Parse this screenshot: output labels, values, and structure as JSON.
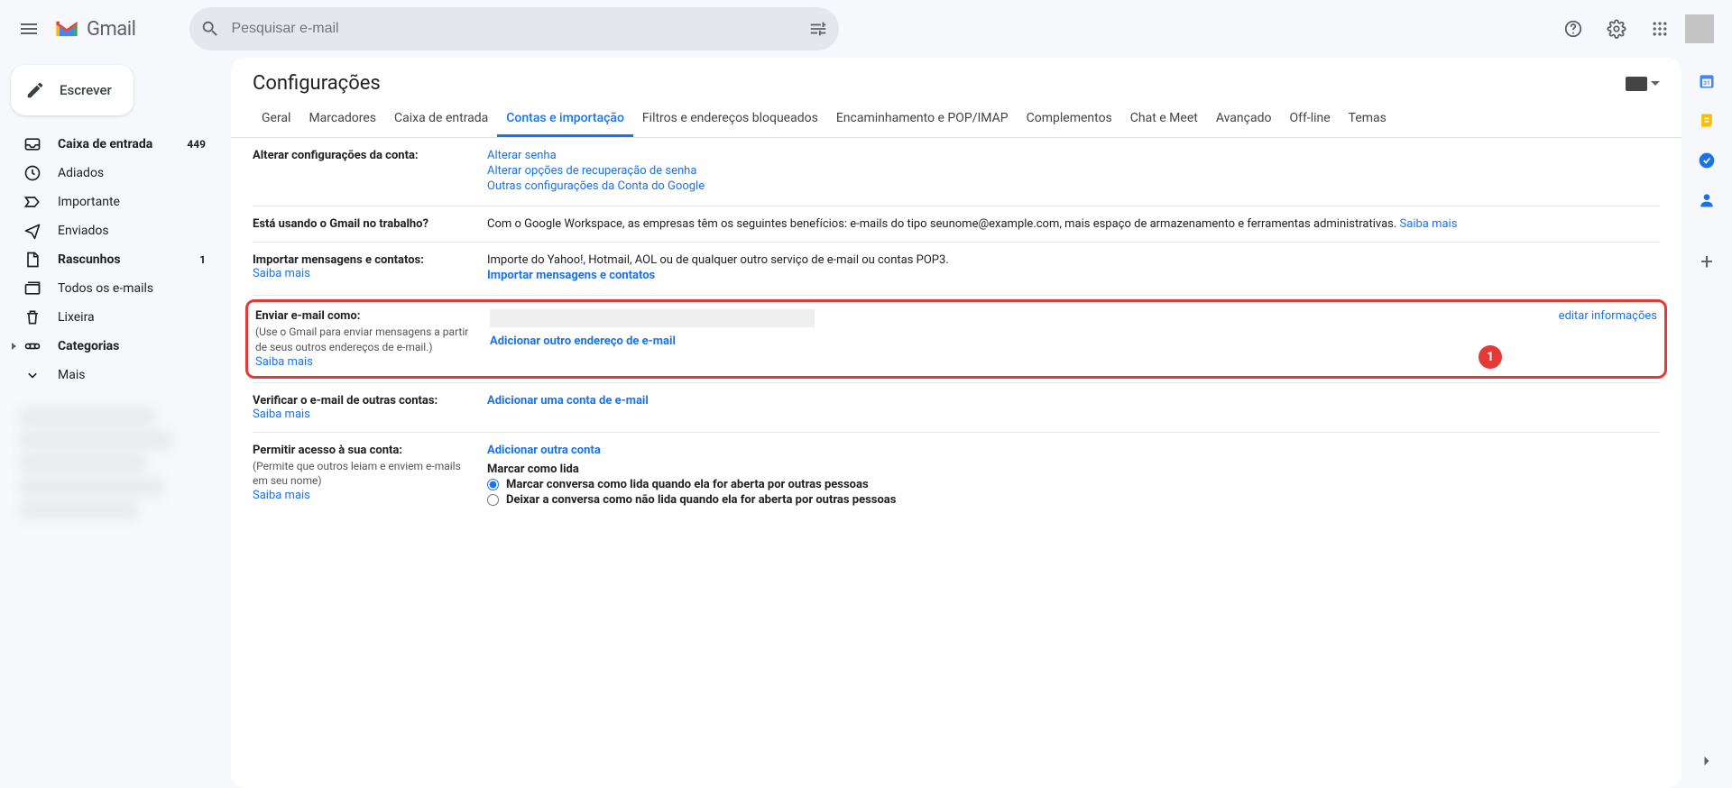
{
  "header": {
    "logo_text": "Gmail",
    "search_placeholder": "Pesquisar e-mail"
  },
  "sidebar": {
    "compose": "Escrever",
    "items": [
      {
        "icon": "inbox",
        "label": "Caixa de entrada",
        "count": "449",
        "bold": true
      },
      {
        "icon": "clock",
        "label": "Adiados"
      },
      {
        "icon": "important",
        "label": "Importante"
      },
      {
        "icon": "sent",
        "label": "Enviados"
      },
      {
        "icon": "draft",
        "label": "Rascunhos",
        "count": "1",
        "bold": true
      },
      {
        "icon": "allmail",
        "label": "Todos os e-mails"
      },
      {
        "icon": "trash",
        "label": "Lixeira"
      },
      {
        "icon": "category",
        "label": "Categorias",
        "caret": true,
        "bold": true
      },
      {
        "icon": "more",
        "label": "Mais"
      }
    ]
  },
  "settings": {
    "title": "Configurações",
    "tabs": [
      "Geral",
      "Marcadores",
      "Caixa de entrada",
      "Contas e importação",
      "Filtros e endereços bloqueados",
      "Encaminhamento e POP/IMAP",
      "Complementos",
      "Chat e Meet",
      "Avançado",
      "Off-line",
      "Temas"
    ],
    "active_tab_index": 3,
    "rows": {
      "account": {
        "title": "Alterar configurações da conta:",
        "links": [
          "Alterar senha",
          "Alterar opções de recuperação de senha",
          "Outras configurações da Conta do Google"
        ]
      },
      "work": {
        "title": "Está usando o Gmail no trabalho?",
        "body_pre": "Com o Google Workspace, as empresas têm os seguintes benefícios: e-mails do tipo seunome@example.com, mais espaço de armazenamento e ferramentas administrativas. ",
        "learn": "Saiba mais"
      },
      "import": {
        "title": "Importar mensagens e contatos:",
        "learn": "Saiba mais",
        "body": "Importe do Yahoo!, Hotmail, AOL ou de qualquer outro serviço de e-mail ou contas POP3.",
        "action": "Importar mensagens e contatos"
      },
      "sendas": {
        "title": "Enviar e-mail como:",
        "subtitle": "(Use o Gmail para enviar mensagens a partir de seus outros endereços de e-mail.)",
        "learn": "Saiba mais",
        "action": "Adicionar outro endereço de e-mail",
        "edit": "editar informações",
        "badge": "1"
      },
      "check": {
        "title": "Verificar o e-mail de outras contas:",
        "learn": "Saiba mais",
        "action": "Adicionar uma conta de e-mail"
      },
      "grant": {
        "title": "Permitir acesso à sua conta:",
        "subtitle": "(Permite que outros leiam e enviem e-mails em seu nome)",
        "learn": "Saiba mais",
        "action": "Adicionar outra conta",
        "mark_header": "Marcar como lida",
        "radio1": "Marcar conversa como lida quando ela for aberta por outras pessoas",
        "radio2": "Deixar a conversa como não lida quando ela for aberta por outras pessoas"
      }
    }
  }
}
